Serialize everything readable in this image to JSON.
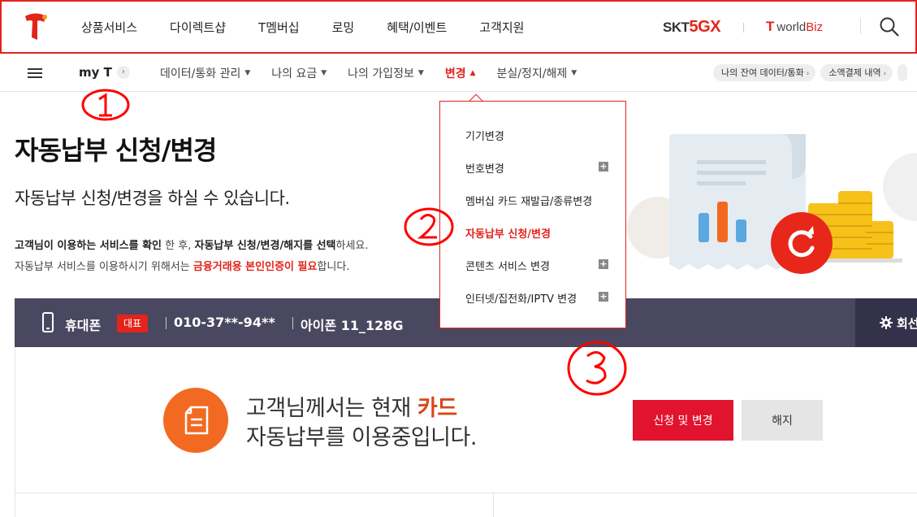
{
  "top_nav": {
    "items": [
      "상품서비스",
      "다이렉트샵",
      "T멤버십",
      "로밍",
      "혜택/이벤트",
      "고객지원"
    ],
    "skt_5gx": {
      "skt": "SKT",
      "five_g": "5G",
      "x": "X"
    },
    "worldbiz": {
      "t": "T",
      "world": "world",
      "biz": "Biz"
    }
  },
  "sub_nav": {
    "myt_label": "my T",
    "myt_arrow": "›",
    "items": [
      "데이터/통화 관리",
      "나의 요금",
      "나의 가입정보",
      "변경",
      "분실/정지/해제"
    ],
    "chevron_down": "⌄",
    "chevron_up": "^",
    "pills": [
      "나의 잔여 데이터/통화",
      "소액결제 내역"
    ],
    "pill_arrow": "›"
  },
  "hero": {
    "title": "자동납부 신청/변경",
    "subtitle": "자동납부 신청/변경을 하실 수 있습니다.",
    "desc1_bold": "고객님이 이용하는 서비스를 확인",
    "desc1_mid": " 한 후, ",
    "desc1_bold2": "자동납부 신청/변경/해지를 선택",
    "desc1_tail": "하세요.",
    "desc2_pre": "자동납부 서비스를 이용하시기 위해서는 ",
    "desc2_hl": "금융거래용 본인인증이 필요",
    "desc2_post": "합니다."
  },
  "device_bar": {
    "type": "휴대폰",
    "badge": "대표",
    "number": "010-37**-94**",
    "model": "아이폰 11_128G",
    "gear_label": "회선"
  },
  "status": {
    "line1_pre": "고객님께서는 현재 ",
    "line1_pay": "카드",
    "line2": "자동납부를 이용중입니다."
  },
  "buttons": {
    "apply": "신청 및 변경",
    "cancel": "해지"
  },
  "dropdown": {
    "items": [
      {
        "label": "기기변경",
        "plus": false,
        "active": false
      },
      {
        "label": "번호변경",
        "plus": true,
        "active": false
      },
      {
        "label": "멤버십 카드 재발급/종류변경",
        "plus": false,
        "active": false
      },
      {
        "label": "자동납부 신청/변경",
        "plus": false,
        "active": true
      },
      {
        "label": "콘텐츠 서비스 변경",
        "plus": true,
        "active": false
      },
      {
        "label": "인터넷/집전화/IPTV 변경",
        "plus": true,
        "active": false
      }
    ],
    "plus_symbol": "+"
  },
  "colors": {
    "brand_red": "#e2241b",
    "device_bar": "#4a4860",
    "accent_orange": "#f26a21"
  }
}
